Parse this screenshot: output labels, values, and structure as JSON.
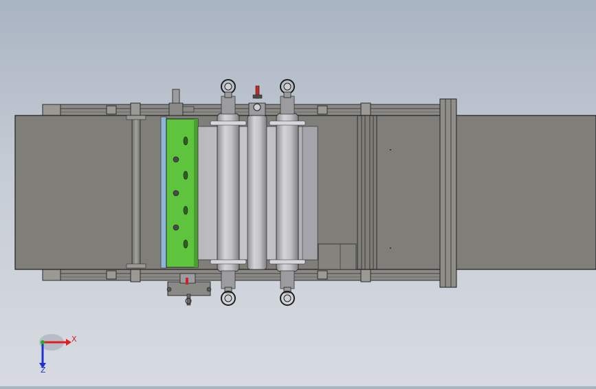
{
  "viewport": {
    "background_top": "#a9b4c2",
    "background_bottom": "#d7dbe1"
  },
  "model": {
    "body_color": "#7f7e79",
    "roller_color": "#bcbcc0",
    "accent_green": "#5ec43d",
    "accent_red": "#c0282a"
  },
  "triad": {
    "x_label": "X",
    "z_label": "Z",
    "x_color": "#e02020",
    "y_color": "#20b020",
    "z_color": "#2030d0"
  }
}
